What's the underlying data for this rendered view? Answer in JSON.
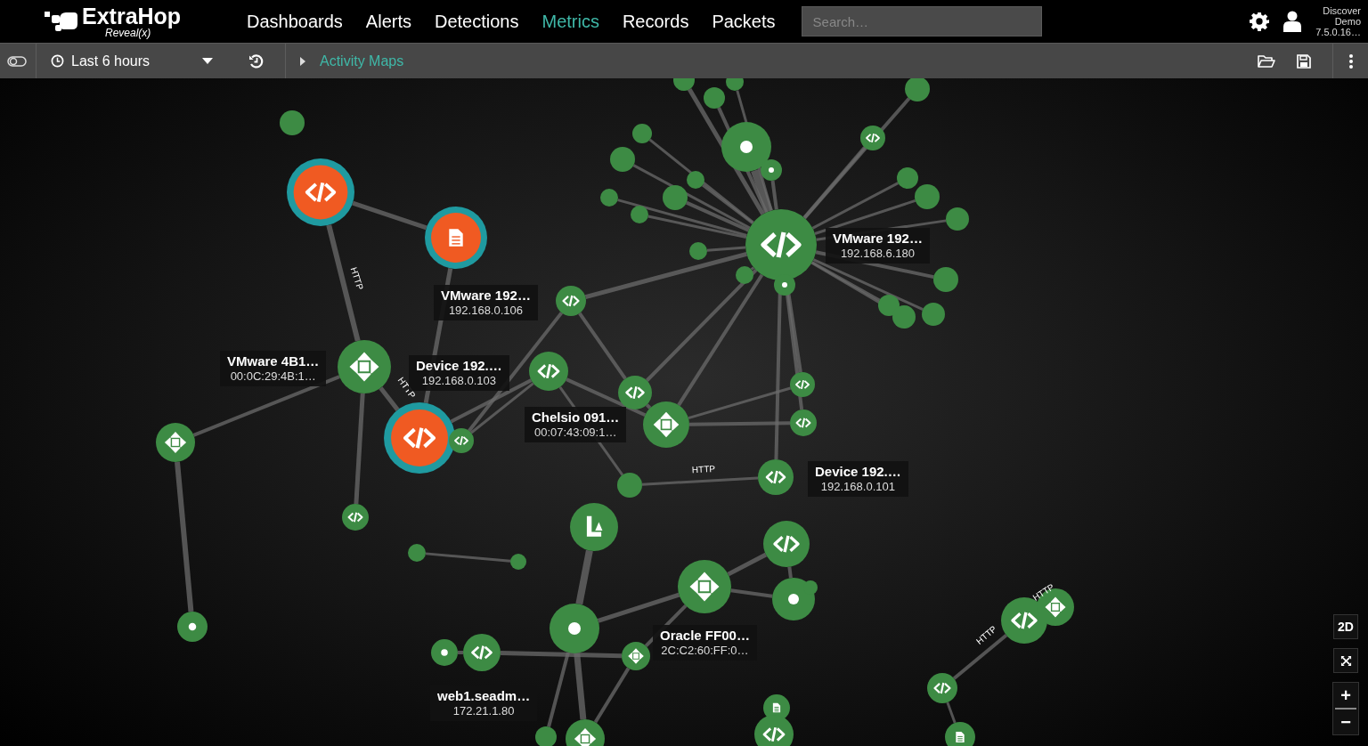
{
  "header": {
    "logo": {
      "name": "ExtraHop",
      "product": "Reveal(x)"
    },
    "nav": [
      {
        "label": "Dashboards",
        "selected": false
      },
      {
        "label": "Alerts",
        "selected": false
      },
      {
        "label": "Detections",
        "selected": false
      },
      {
        "label": "Metrics",
        "selected": true
      },
      {
        "label": "Records",
        "selected": false
      },
      {
        "label": "Packets",
        "selected": false
      }
    ],
    "search": {
      "placeholder": "Search…"
    },
    "appliance": [
      "Discover",
      "Demo",
      "7.5.0.16…"
    ]
  },
  "toolbar": {
    "time_range": "Last 6 hours",
    "breadcrumb": "Activity Maps"
  },
  "map": {
    "device_labels": [
      {
        "name": "VMware 192…",
        "address": "192.168.6.180"
      },
      {
        "name": "VMware 192…",
        "address": "192.168.0.106"
      },
      {
        "name": "VMware 4B1…",
        "address": "00:0C:29:4B:1…"
      },
      {
        "name": "Device 192.…",
        "address": "192.168.0.103"
      },
      {
        "name": "Chelsio 091…",
        "address": "00:07:43:09:1…"
      },
      {
        "name": "Device 192.…",
        "address": "192.168.0.101"
      },
      {
        "name": "Oracle FF00…",
        "address": "2C:C2:60:FF:0…"
      },
      {
        "name": "web1.seadm…",
        "address": "172.21.1.80"
      }
    ],
    "edge_labels": [
      "HTTP",
      "HTTP",
      "HTTP",
      "HTTP",
      "HTTP"
    ]
  },
  "view_controls": {
    "mode": "2D",
    "zoom_in": "+",
    "zoom_out": "−"
  }
}
